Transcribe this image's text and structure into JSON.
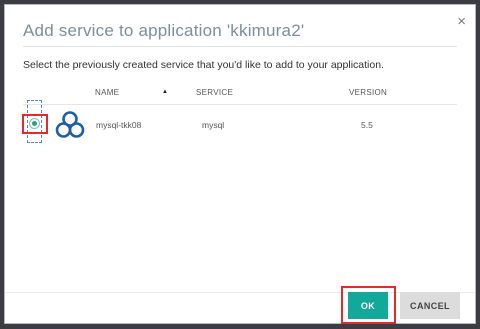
{
  "dialog": {
    "title": "Add service to application 'kkimura2'",
    "close_glyph": "×",
    "description": "Select the previously created service that you'd like to add to your application."
  },
  "table": {
    "columns": [
      "NAME",
      "SERVICE",
      "VERSION"
    ],
    "sort_indicator": "▲",
    "rows": [
      {
        "selected": true,
        "icon": "mysql-triangle-logo-icon",
        "name": "mysql-tkk08",
        "service": "mysql",
        "version": "5.5"
      }
    ]
  },
  "footer": {
    "ok_label": "OK",
    "cancel_label": "CANCEL"
  },
  "colors": {
    "accent": "#13a99a",
    "title": "#7d8f9a",
    "highlight": "#e52a2a",
    "logo": "#1f5ea8"
  }
}
